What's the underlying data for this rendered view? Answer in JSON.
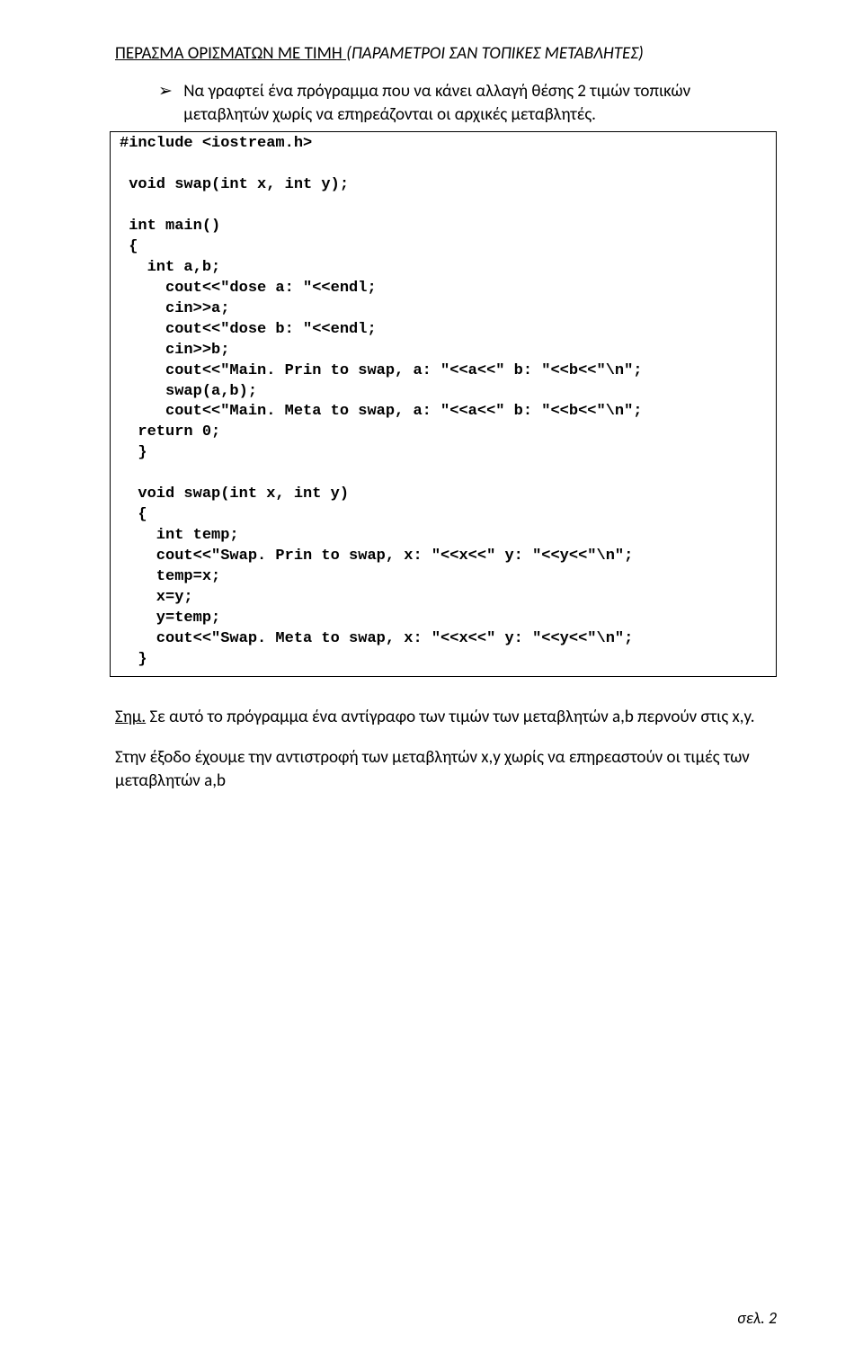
{
  "heading": {
    "underlined": "ΠΕΡΑΣΜΑ ΟΡΙΣΜΑΤΩΝ ΜΕ ΤΙΜΗ  ",
    "italic": "(ΠΑΡΑΜΕΤΡΟΙ ΣΑΝ ΤΟΠΙΚΕΣ ΜΕΤΑΒΛΗΤΕΣ)"
  },
  "bullet": {
    "arrow": "➢",
    "text": "Να γραφτεί ένα πρόγραμμα που να κάνει αλλαγή θέσης 2 τιμών τοπικών μεταβλητών χωρίς να επηρεάζονται οι αρχικές μεταβλητές."
  },
  "code": "#include <iostream.h>\n\n void swap(int x, int y);\n\n int main()\n {\n   int a,b;\n     cout<<\"dose a: \"<<endl;\n     cin>>a;\n     cout<<\"dose b: \"<<endl;\n     cin>>b;\n     cout<<\"Main. Prin to swap, a: \"<<a<<\" b: \"<<b<<\"\\n\";\n     swap(a,b);\n     cout<<\"Main. Meta to swap, a: \"<<a<<\" b: \"<<b<<\"\\n\";\n  return 0;\n  }\n\n  void swap(int x, int y)\n  {\n    int temp;\n    cout<<\"Swap. Prin to swap, x: \"<<x<<\" y: \"<<y<<\"\\n\";\n    temp=x;\n    x=y;\n    y=temp;\n    cout<<\"Swap. Meta to swap, x: \"<<x<<\" y: \"<<y<<\"\\n\";\n  }",
  "note": {
    "label": "Σημ.",
    "line1": " Σε αυτό το πρόγραμμα ένα αντίγραφο των τιμών των μεταβλητών a,b περνούν στις x,y.",
    "line2": "Στην έξοδο έχουμε την αντιστροφή των μεταβλητών x,y χωρίς να επηρεαστούν οι τιμές των μεταβλητών a,b"
  },
  "footer": "σελ. 2"
}
